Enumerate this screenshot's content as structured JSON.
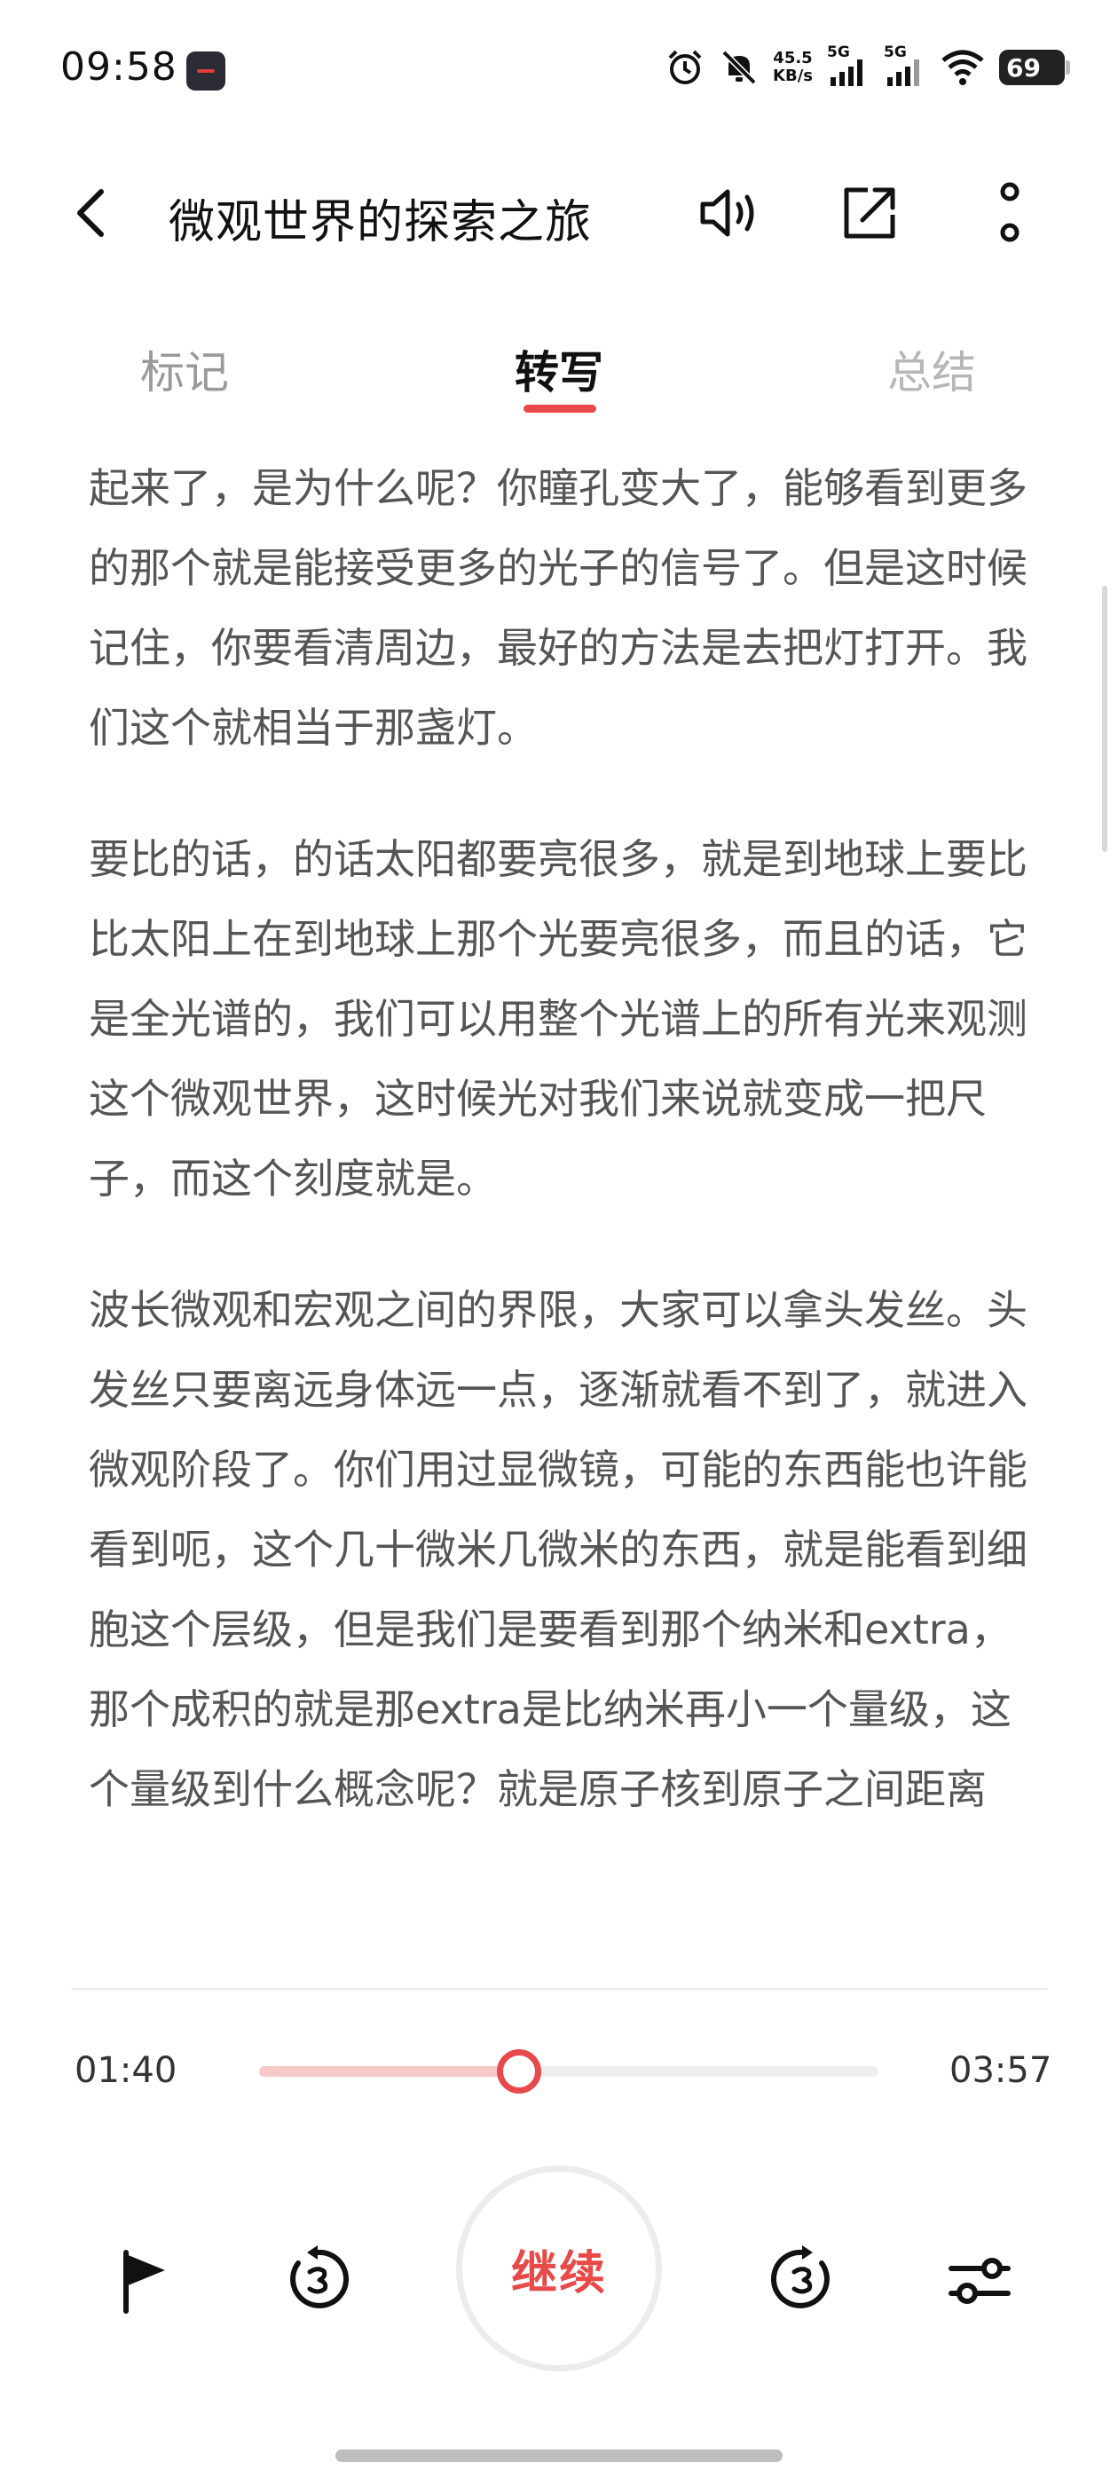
{
  "status_bar": {
    "time": "09:58",
    "net_speed_value": "45.5",
    "net_speed_unit": "KB/s",
    "sim1": "5G",
    "sim2": "5G",
    "battery": "69",
    "icons": [
      "recorder-app-icon",
      "alarm-icon",
      "mute-icon",
      "signal-icon",
      "signal-icon",
      "wifi-icon",
      "battery-icon"
    ]
  },
  "header": {
    "title": "微观世界的探索之旅",
    "icons": [
      "back-icon",
      "speaker-icon",
      "share-icon",
      "more-icon"
    ]
  },
  "tabs": {
    "marks": "标记",
    "transcript": "转写",
    "summary": "总结",
    "active": "transcript"
  },
  "transcript": {
    "paragraphs": [
      "起来了，是为什么呢？你瞳孔变大了，能够看到更多的那个就是能接受更多的光子的信号了。但是这时候记住，你要看清周边，最好的方法是去把灯打开。我们这个就相当于那盏灯。",
      "要比的话，的话太阳都要亮很多，就是到地球上要比比太阳上在到地球上那个光要亮很多，而且的话，它是全光谱的，我们可以用整个光谱上的所有光来观测这个微观世界，这时候光对我们来说就变成一把尺子，而这个刻度就是。",
      "波长微观和宏观之间的界限，大家可以拿头发丝。头发丝只要离远身体远一点，逐渐就看不到了，就进入微观阶段了。你们用过显微镜，可能的东西能也许能看到呃，这个几十微米几微米的东西，就是能看到细胞这个层级，但是我们是要看到那个纳米和extra，那个成积的就是那extra是比纳米再小一个量级，这个量级到什么概念呢？就是原子核到原子之间距离"
    ]
  },
  "player": {
    "current_time": "01:40",
    "total_time": "03:57",
    "progress_fraction": 0.42,
    "play_label": "继续",
    "accent_color": "#e84a4a",
    "icons": [
      "flag-icon",
      "rewind-3s-icon",
      "forward-3s-icon",
      "settings-sliders-icon"
    ]
  }
}
